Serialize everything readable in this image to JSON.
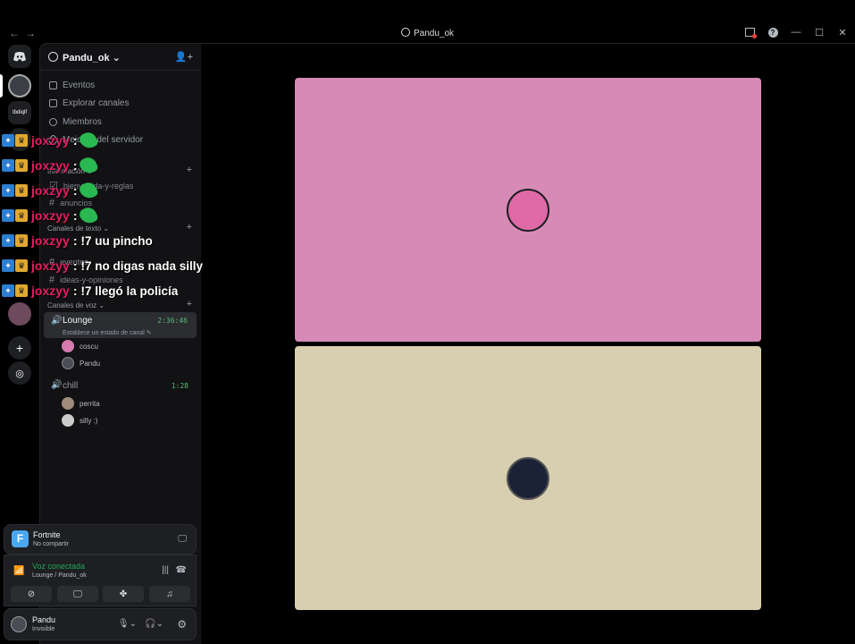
{
  "window": {
    "title": "Pandu_ok"
  },
  "server": {
    "name": "Pandu_ok"
  },
  "nav": {
    "events": "Eventos",
    "browse": "Explorar canales",
    "members": "Miembros",
    "boosts": "Mejoras del servidor"
  },
  "categories": {
    "info": "Información",
    "text": "Canales de texto",
    "voice": "Canales de voz"
  },
  "text_channels": {
    "welcome": "bienvenida-y-reglas",
    "announcements": "anuncios",
    "events": "eventos",
    "ideas": "ideas-y-opiniones"
  },
  "voice_channels": {
    "lounge": {
      "name": "Lounge",
      "time": "2:36:46",
      "status": "Establece un estado de canal",
      "members": [
        "coscu",
        "Pandu"
      ]
    },
    "chill": {
      "name": "chill",
      "time": "1:28",
      "members": [
        "perrita",
        "silly :)"
      ]
    }
  },
  "activity": {
    "game": "Fortnite",
    "sub": "No compartir"
  },
  "voice_status": {
    "title": "Voz conectada",
    "sub": "Lounge / Pandu_ok"
  },
  "user": {
    "name": "Pandu",
    "status": "Invisible"
  },
  "rail": {
    "label": "Ibdiqlf"
  },
  "chat": [
    {
      "user": "joxzyy",
      "text": ""
    },
    {
      "user": "joxzyy",
      "text": ""
    },
    {
      "user": "joxzyy",
      "text": ""
    },
    {
      "user": "joxzyy",
      "text": ""
    },
    {
      "user": "joxzyy",
      "text": "!7 uu pincho"
    },
    {
      "user": "joxzyy",
      "text": "!7 no digas nada silly"
    },
    {
      "user": "joxzyy",
      "text": "!7 llegó la policía"
    }
  ],
  "colors": {
    "tile_top": "#d68ab5",
    "tile_bottom": "#d8cfb0",
    "accent_green": "#23a55a",
    "chat_name": "#e41e63"
  }
}
